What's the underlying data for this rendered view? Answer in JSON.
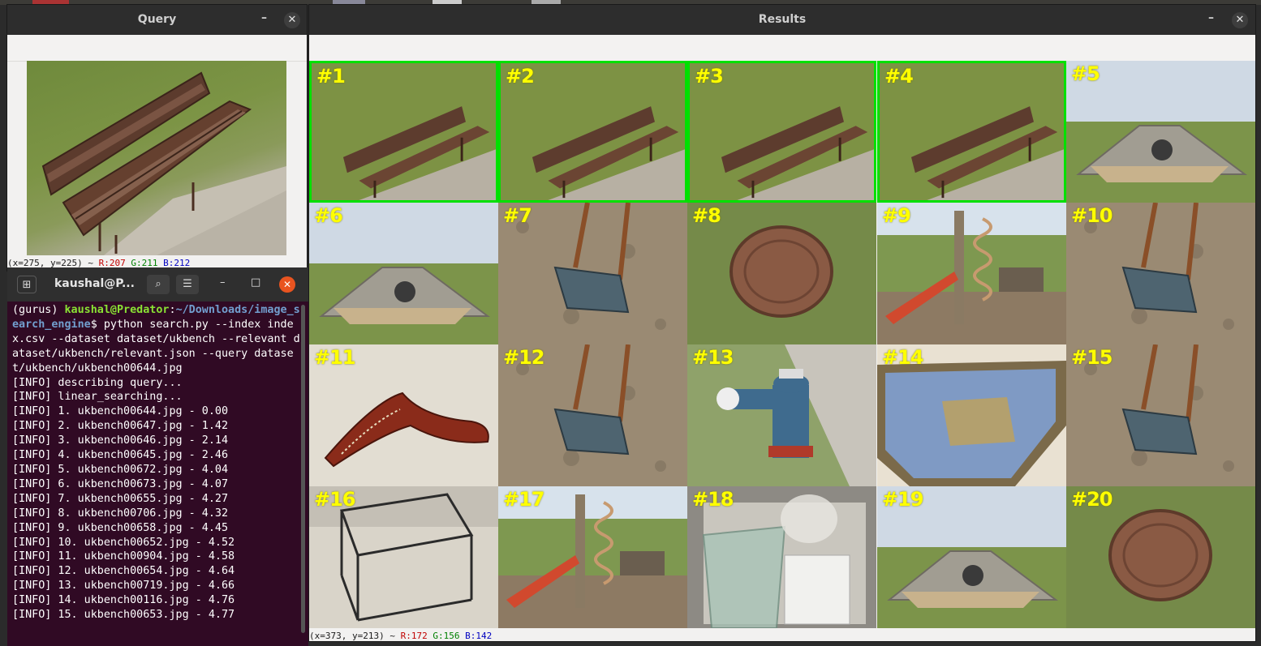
{
  "query_window": {
    "title": "Query",
    "minimize": "–",
    "close": "✕",
    "status": {
      "prefix": "(x=275, y=225) ~ ",
      "r": "R:207",
      "g": "G:211",
      "b": "B:212"
    }
  },
  "results_window": {
    "title": "Results",
    "minimize": "–",
    "close": "✕",
    "status": {
      "prefix": "(x=373, y=213) ~ ",
      "r": "R:172",
      "g": "G:156",
      "b": "B:142"
    },
    "results": [
      {
        "label": "#1",
        "scene": "bench",
        "highlighted": true
      },
      {
        "label": "#2",
        "scene": "bench",
        "highlighted": true
      },
      {
        "label": "#3",
        "scene": "bench",
        "highlighted": true
      },
      {
        "label": "#4",
        "scene": "bench",
        "highlighted": true
      },
      {
        "label": "#5",
        "scene": "culvert",
        "highlighted": false
      },
      {
        "label": "#6",
        "scene": "culvert",
        "highlighted": false
      },
      {
        "label": "#7",
        "scene": "swing",
        "highlighted": false
      },
      {
        "label": "#8",
        "scene": "manhole",
        "highlighted": false
      },
      {
        "label": "#9",
        "scene": "slide",
        "highlighted": false
      },
      {
        "label": "#10",
        "scene": "swing",
        "highlighted": false
      },
      {
        "label": "#11",
        "scene": "boomerang",
        "highlighted": false
      },
      {
        "label": "#12",
        "scene": "swing",
        "highlighted": false
      },
      {
        "label": "#13",
        "scene": "hydrant",
        "highlighted": false
      },
      {
        "label": "#14",
        "scene": "painting",
        "highlighted": false
      },
      {
        "label": "#15",
        "scene": "swing",
        "highlighted": false
      },
      {
        "label": "#16",
        "scene": "stand",
        "highlighted": false
      },
      {
        "label": "#17",
        "scene": "slide",
        "highlighted": false
      },
      {
        "label": "#18",
        "scene": "blender",
        "highlighted": false
      },
      {
        "label": "#19",
        "scene": "culvert",
        "highlighted": false
      },
      {
        "label": "#20",
        "scene": "manhole",
        "highlighted": false
      }
    ]
  },
  "terminal": {
    "title": "kaushal@P...",
    "search_icon": "search-icon",
    "menu_icon": "hamburger-icon",
    "prompt_env": "(gurus) ",
    "prompt_user": "kaushal@Predator",
    "prompt_path": "~/Downloads/image_search_engine",
    "command": "$ python search.py --index index.csv --dataset dataset/ukbench --relevant dataset/ukbench/relevant.json --query dataset/ukbench/ukbench00644.jpg",
    "lines": [
      "[INFO] describing query...",
      "[INFO] linear_searching...",
      "[INFO] 1. ukbench00644.jpg - 0.00",
      "[INFO] 2. ukbench00647.jpg - 1.42",
      "[INFO] 3. ukbench00646.jpg - 2.14",
      "[INFO] 4. ukbench00645.jpg - 2.46",
      "[INFO] 5. ukbench00672.jpg - 4.04",
      "[INFO] 6. ukbench00673.jpg - 4.07",
      "[INFO] 7. ukbench00655.jpg - 4.27",
      "[INFO] 8. ukbench00706.jpg - 4.32",
      "[INFO] 9. ukbench00658.jpg - 4.45",
      "[INFO] 10. ukbench00652.jpg - 4.52",
      "[INFO] 11. ukbench00904.jpg - 4.58",
      "[INFO] 12. ukbench00654.jpg - 4.64",
      "[INFO] 13. ukbench00719.jpg - 4.66",
      "[INFO] 14. ukbench00116.jpg - 4.76",
      "[INFO] 15. ukbench00653.jpg - 4.77"
    ]
  }
}
